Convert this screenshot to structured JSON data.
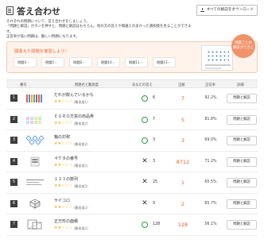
{
  "header": {
    "title": "答え合わせ",
    "download_label": "すべての解説をダウンロード"
  },
  "intro": {
    "line1": "それぞれの問題について、答え合わせをしましょう。",
    "line2": "「問題と解説」ボタンを押すと、問題と解説はもちろん、他の方の答えや間違えの多かった選択肢を見ることができます。",
    "line3": "正答率が低い問題は、難しい問題になります。"
  },
  "filter": {
    "title": "間違えた問題を復習しよう！",
    "chips": [
      "問題4 ›",
      "問題5 ›",
      "問題8 ›",
      "問題10 ›",
      "問題11 ›",
      "問題13 ›"
    ],
    "badge_line1": "問題ごとの",
    "badge_line2": "解説ができた"
  },
  "table": {
    "headers": {
      "num": "番号",
      "name": "問題名と難易度",
      "mine": "あなたの答え",
      "correct": "正解",
      "rate": "正答率",
      "expl": "詳細"
    },
    "rows": [
      {
        "num": "1",
        "name": "だれが飲んでいるかな",
        "stars": "★★☆☆☆",
        "diff": "(難易度1)",
        "mark": "o",
        "my": "6",
        "correct": "7",
        "rate": "92.2%",
        "btn": "問題と解説"
      },
      {
        "num": "2",
        "name": "ＥＵＲＯ方貨の商品券",
        "stars": "★★☆☆☆",
        "diff": "(難易度2)",
        "mark": "o",
        "my": "7",
        "correct": "5",
        "rate": "81.8%",
        "btn": "問題と解説"
      },
      {
        "num": "3",
        "name": "軸の対称",
        "stars": "★★☆☆☆",
        "diff": "(難易度2)",
        "mark": "o",
        "my": "3",
        "correct": "3",
        "rate": "69.0%",
        "btn": "問題と解説"
      },
      {
        "num": "4",
        "name": "４ケタの番号",
        "stars": "★★☆☆☆",
        "diff": "(難易度2)",
        "mark": "x",
        "my": "3",
        "correct": "8712",
        "rate": "71.2%",
        "btn": "問題と解説"
      },
      {
        "num": "5",
        "name": "１２３の数列",
        "stars": "★★☆☆☆",
        "diff": "(難易度2)",
        "mark": "x",
        "my": "25",
        "correct": "1",
        "rate": "65.5%",
        "btn": "問題と解説"
      },
      {
        "num": "6",
        "name": "サイコロ",
        "stars": "★★☆☆☆",
        "diff": "(難易度2)",
        "mark": "x",
        "my": "3",
        "correct": "2",
        "rate": "65.7%",
        "btn": "問題と解説"
      },
      {
        "num": "7",
        "name": "正方形の面積",
        "stars": "★★☆☆☆",
        "diff": "(難易度2)",
        "mark": "o",
        "my": "128",
        "correct": "128",
        "rate": "56.1%",
        "btn": "問題と解説"
      }
    ]
  },
  "colors": {
    "accent": "#e8612a",
    "correct_mark": "#2c9a45",
    "stars": "#f2b01e"
  }
}
